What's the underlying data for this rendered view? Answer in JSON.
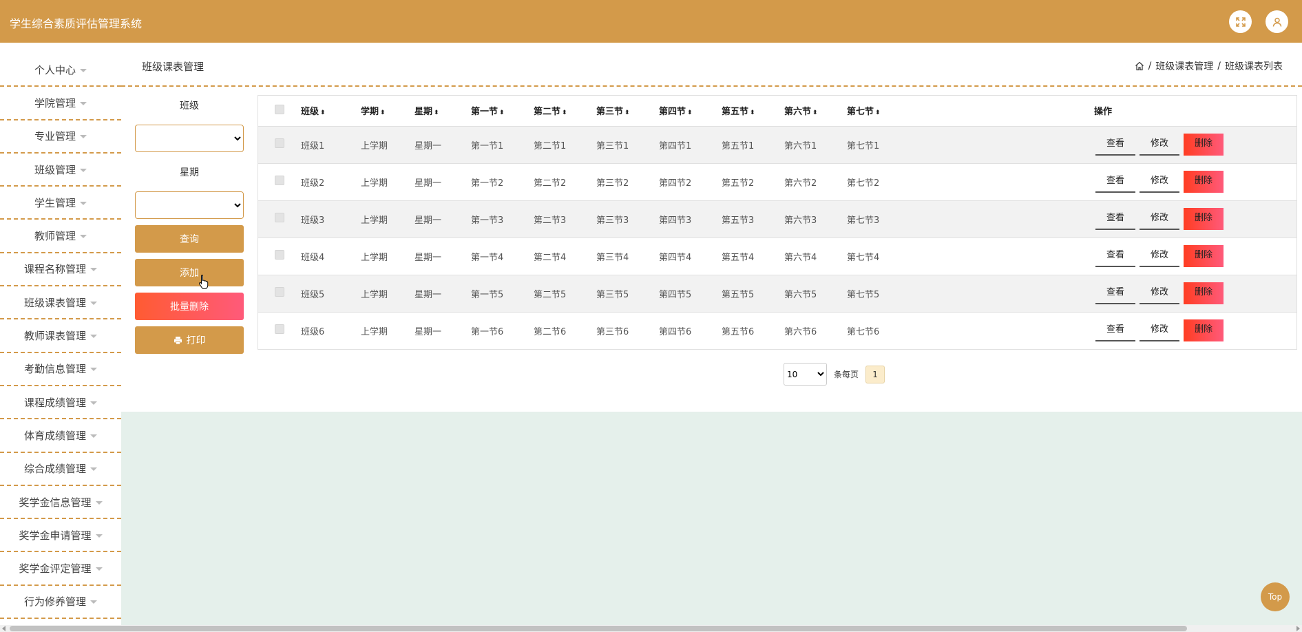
{
  "header": {
    "title": "学生综合素质评估管理系统"
  },
  "sidebar": {
    "items": [
      {
        "label": "个人中心"
      },
      {
        "label": "学院管理"
      },
      {
        "label": "专业管理"
      },
      {
        "label": "班级管理"
      },
      {
        "label": "学生管理"
      },
      {
        "label": "教师管理"
      },
      {
        "label": "课程名称管理"
      },
      {
        "label": "班级课表管理"
      },
      {
        "label": "教师课表管理"
      },
      {
        "label": "考勤信息管理"
      },
      {
        "label": "课程成绩管理"
      },
      {
        "label": "体育成绩管理"
      },
      {
        "label": "综合成绩管理"
      },
      {
        "label": "奖学金信息管理"
      },
      {
        "label": "奖学金申请管理"
      },
      {
        "label": "奖学金评定管理"
      },
      {
        "label": "行为修养管理"
      }
    ]
  },
  "topbar": {
    "page_title": "班级课表管理",
    "breadcrumb": [
      "班级课表管理",
      "班级课表列表"
    ],
    "separator": "/"
  },
  "filter": {
    "class_label": "班级",
    "weekday_label": "星期",
    "search_button": "查询",
    "add_button": "添加",
    "batch_delete_button": "批量删除",
    "print_button": "打印"
  },
  "table": {
    "columns": [
      "班级",
      "学期",
      "星期",
      "第一节",
      "第二节",
      "第三节",
      "第四节",
      "第五节",
      "第六节",
      "第七节"
    ],
    "action_header": "操作",
    "rows": [
      [
        "班级1",
        "上学期",
        "星期一",
        "第一节1",
        "第二节1",
        "第三节1",
        "第四节1",
        "第五节1",
        "第六节1",
        "第七节1"
      ],
      [
        "班级2",
        "上学期",
        "星期一",
        "第一节2",
        "第二节2",
        "第三节2",
        "第四节2",
        "第五节2",
        "第六节2",
        "第七节2"
      ],
      [
        "班级3",
        "上学期",
        "星期一",
        "第一节3",
        "第二节3",
        "第三节3",
        "第四节3",
        "第五节3",
        "第六节3",
        "第七节3"
      ],
      [
        "班级4",
        "上学期",
        "星期一",
        "第一节4",
        "第二节4",
        "第三节4",
        "第四节4",
        "第五节4",
        "第六节4",
        "第七节4"
      ],
      [
        "班级5",
        "上学期",
        "星期一",
        "第一节5",
        "第二节5",
        "第三节5",
        "第四节5",
        "第五节5",
        "第六节5",
        "第七节5"
      ],
      [
        "班级6",
        "上学期",
        "星期一",
        "第一节6",
        "第二节6",
        "第三节6",
        "第四节6",
        "第五节6",
        "第六节6",
        "第七节6"
      ]
    ],
    "actions": {
      "view": "查看",
      "edit": "修改",
      "delete": "删除"
    }
  },
  "pager": {
    "page_size": "10",
    "per_page_label": "条每页",
    "current_page": "1"
  },
  "to_top": "Top",
  "colors": {
    "brand": "#d39a4a",
    "danger": "#ff4d3a",
    "content_bg": "#e5f0eb"
  }
}
